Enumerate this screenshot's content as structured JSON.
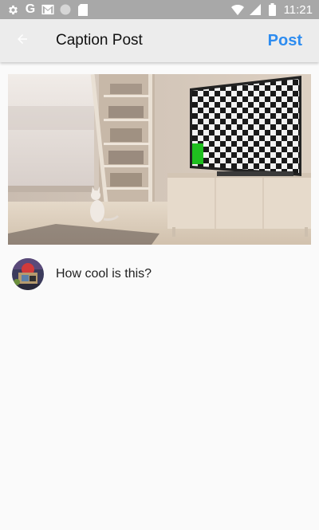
{
  "status_bar": {
    "time": "11:21",
    "left_icons": [
      "gear-icon",
      "google-icon",
      "gmail-icon",
      "circle-icon",
      "sd-card-icon"
    ],
    "right_icons": [
      "wifi-icon",
      "signal-icon",
      "battery-icon"
    ]
  },
  "app_bar": {
    "back_icon": "arrow-left-icon",
    "title": "Caption Post",
    "action_label": "Post"
  },
  "post": {
    "image_description_icon": "photo",
    "caption": "How cool is this?"
  },
  "colors": {
    "accent": "#2d8cf0",
    "status_bar": "#a8a8a8",
    "app_bar": "#ececec",
    "background": "#fafafa",
    "green_square": "#1fbf1f"
  }
}
